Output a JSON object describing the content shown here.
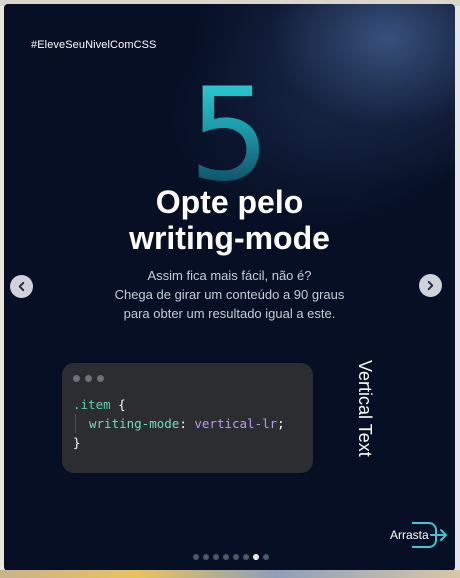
{
  "post": {
    "hashtag": "#EleveSeuNivelComCSS",
    "number": "5",
    "headline_line1": "Opte pelo",
    "headline_line2": "writing-mode",
    "subtitle_line1": "Assim fica mais fácil, não é?",
    "subtitle_line2": "Chega de girar um conteúdo a 90 graus",
    "subtitle_line3": "para obter um resultado igual a este."
  },
  "code": {
    "selector": ".item",
    "open_brace": " {",
    "property": "writing-mode",
    "colon": ": ",
    "value": "vertical-lr",
    "semicolon": ";",
    "close_brace": "}"
  },
  "demo": {
    "vertical_text": "Vertical Text"
  },
  "cta": {
    "label": "Arrasta"
  },
  "carousel": {
    "slide_count": 8,
    "active_index": 6
  },
  "colors": {
    "background": "#060f24",
    "accent": "#2fd3d9",
    "code_bg": "#2b2d31"
  },
  "icons": {
    "prev": "chevron-left-icon",
    "next": "chevron-right-icon",
    "cta": "arrow-right-icon"
  }
}
